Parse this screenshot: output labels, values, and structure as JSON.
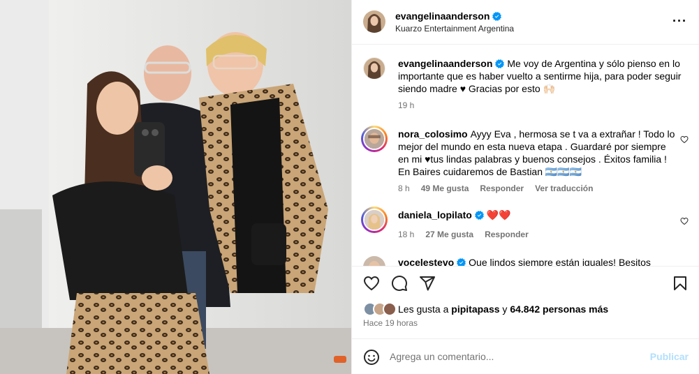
{
  "header": {
    "username": "evangelinaanderson",
    "subtitle": "Kuarzo Entertainment Argentina",
    "more_icon": "more-horizontal-icon"
  },
  "caption": {
    "username": "evangelinaanderson",
    "text": "Me voy de Argentina y sólo pienso en lo importante que es haber vuelto a sentirme hija, para poder seguir siendo madre ♥ Gracias por esto 🙌🏻",
    "time": "19 h"
  },
  "comments": [
    {
      "username": "nora_colosimo",
      "text": "Ayyy Eva , hermosa se t va a extrañar ! Todo lo mejor del mundo en esta nueva etapa . Guardaré por siempre en mi ♥tus lindas palabras y buenos consejos . Éxitos familia ! En Baires cuidaremos de Bastian 🇦🇷🇦🇷🇦🇷",
      "time": "8 h",
      "likes": "49 Me gusta",
      "reply": "Responder",
      "translate": "Ver traducción"
    },
    {
      "username": "daniela_lopilato",
      "text": "❤️❤️",
      "time": "18 h",
      "likes": "27 Me gusta",
      "reply": "Responder"
    },
    {
      "username": "vocelestevo",
      "text": "Que lindos siempre están iguales! Besitos"
    }
  ],
  "actions": {
    "like_icon": "heart-icon",
    "comment_icon": "comment-icon",
    "share_icon": "share-icon",
    "save_icon": "bookmark-icon"
  },
  "likes": {
    "prefix": "Les gusta a ",
    "user": "pipitapass",
    "middle": " y ",
    "count": "64.842 personas más"
  },
  "post_time": "Hace 19 horas",
  "add_comment": {
    "placeholder": "Agrega un comentario...",
    "publish": "Publicar",
    "emoji_icon": "emoji-icon"
  },
  "colors": {
    "verified": "#0095f6",
    "publish_disabled": "#b2dffc",
    "secondary_text": "#737373",
    "heart_red": "#e0245e"
  }
}
